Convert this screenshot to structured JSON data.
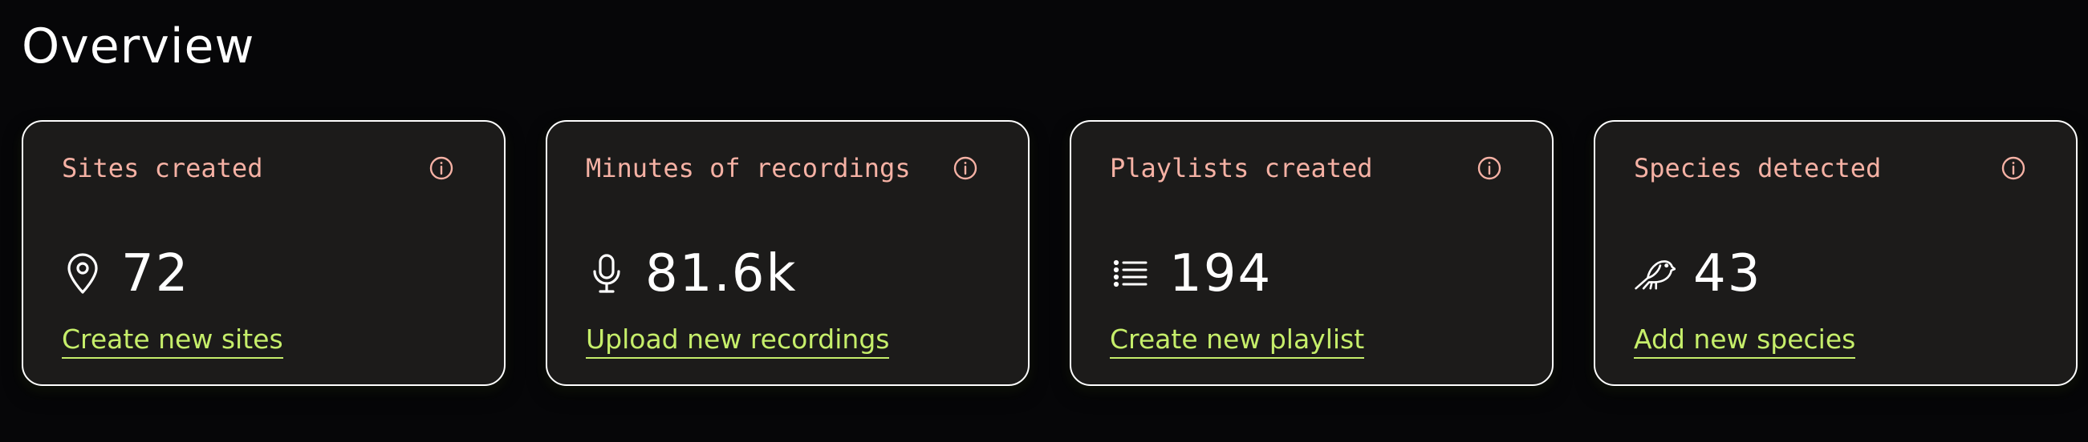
{
  "page": {
    "title": "Overview"
  },
  "cards": [
    {
      "title": "Sites created",
      "value": "72",
      "icon": "map-pin-icon",
      "action": "Create new sites"
    },
    {
      "title": "Minutes of recordings",
      "value": "81.6k",
      "icon": "microphone-icon",
      "action": "Upload new recordings"
    },
    {
      "title": "Playlists created",
      "value": "194",
      "icon": "list-icon",
      "action": "Create new playlist"
    },
    {
      "title": "Species detected",
      "value": "43",
      "icon": "bird-icon",
      "action": "Add new species"
    }
  ],
  "colors": {
    "background": "#060608",
    "card_background": "#1c1b1a",
    "card_border": "#ffffff",
    "title_text": "#f5b1a4",
    "link_text": "#c6ee6a",
    "value_text": "#ffffff"
  }
}
